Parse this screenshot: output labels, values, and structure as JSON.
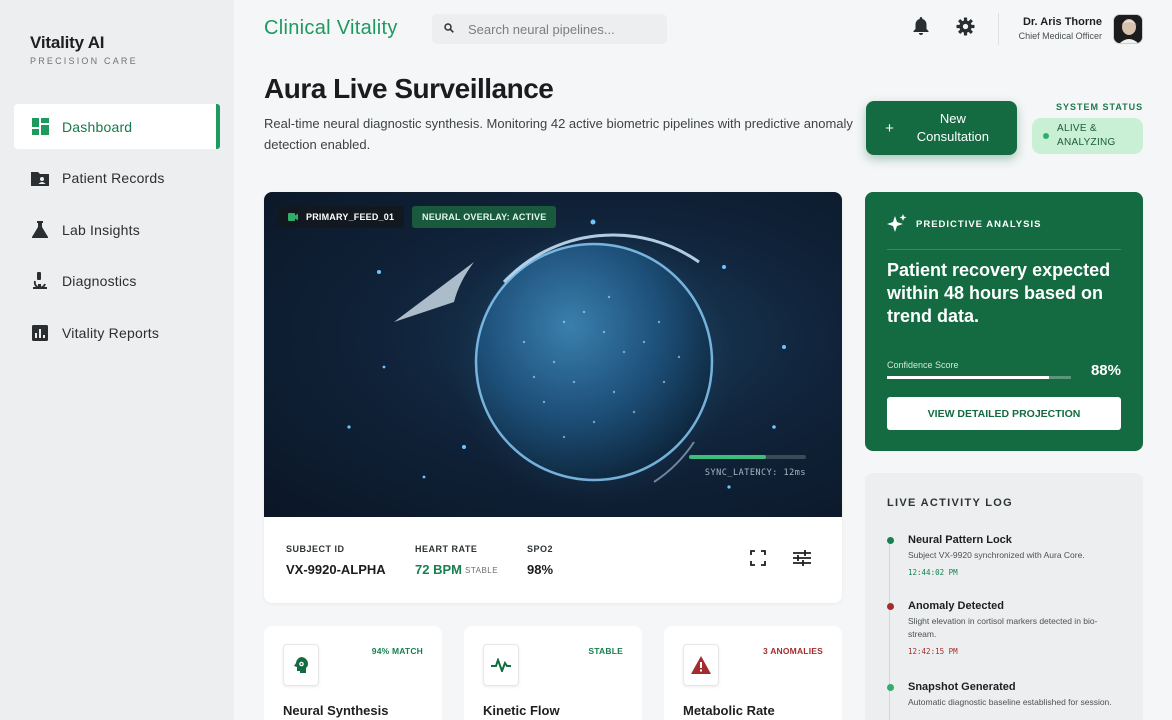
{
  "sidebar": {
    "brand": "Vitality AI",
    "tagline": "PRECISION CARE",
    "items": [
      {
        "label": "Dashboard",
        "icon": "dashboard-icon"
      },
      {
        "label": "Patient Records",
        "icon": "folder-user-icon"
      },
      {
        "label": "Lab Insights",
        "icon": "flask-icon"
      },
      {
        "label": "Diagnostics",
        "icon": "microscope-icon"
      },
      {
        "label": "Vitality Reports",
        "icon": "bar-chart-icon"
      }
    ]
  },
  "header": {
    "app_title": "Clinical Vitality",
    "search_placeholder": "Search neural pipelines...",
    "user_name": "Dr. Aris Thorne",
    "user_role": "Chief Medical Officer"
  },
  "hero": {
    "title": "Aura Live Surveillance",
    "description": "Real-time neural diagnostic synthesis. Monitoring 42 active biometric pipelines with predictive anomaly detection enabled.",
    "new_button_plus": "+",
    "new_button": "New Consultation",
    "status_label": "SYSTEM STATUS",
    "status_value": "ALIVE & ANALYZING"
  },
  "feed": {
    "feed_tag": "PRIMARY_FEED_01",
    "overlay_tag": "NEURAL OVERLAY: ACTIVE",
    "sync_progress": 0.66,
    "sync_text": "SYNC_LATENCY: 12ms",
    "subject_label": "SUBJECT ID",
    "subject_value": "VX-9920-ALPHA",
    "hr_label": "HEART RATE",
    "hr_value": "72 BPM",
    "hr_status": "STABLE",
    "spo2_label": "SPO2",
    "spo2_value": "98%"
  },
  "prediction": {
    "header": "PREDICTIVE ANALYSIS",
    "text": "Patient recovery expected within 48 hours based on trend data.",
    "confidence_label": "Confidence Score",
    "confidence_value": "88%",
    "confidence_fraction": 0.88,
    "button": "VIEW DETAILED PROJECTION"
  },
  "log": {
    "title": "LIVE ACTIVITY LOG",
    "items": [
      {
        "name": "Neural Pattern Lock",
        "desc": "Subject VX-9920 synchronized with Aura Core.",
        "time": "12:44:02 PM",
        "color": "#17804e"
      },
      {
        "name": "Anomaly Detected",
        "desc": "Slight elevation in cortisol markers detected in bio-stream.",
        "time": "12:42:15 PM",
        "color": "#a32d2d"
      },
      {
        "name": "Snapshot Generated",
        "desc": "Automatic diagnostic baseline established for session.",
        "time": "",
        "color": "#2fae6c"
      }
    ]
  },
  "metrics": [
    {
      "name": "Neural Synthesis",
      "badge": "94% MATCH",
      "badge_color": "#17804e",
      "icon": "brain-icon"
    },
    {
      "name": "Kinetic Flow",
      "badge": "STABLE",
      "badge_color": "#17804e",
      "icon": "pulse-icon"
    },
    {
      "name": "Metabolic Rate",
      "badge": "3 ANOMALIES",
      "badge_color": "#a32d2d",
      "icon": "warning-icon"
    }
  ]
}
